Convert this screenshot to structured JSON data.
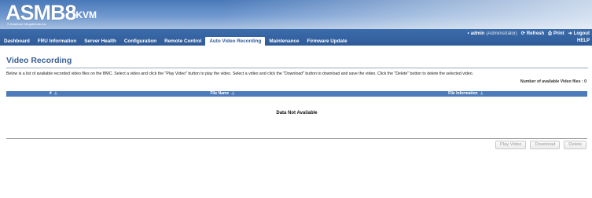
{
  "branding": {
    "logo_main": "ASMB8",
    "logo_sub": "iKVM",
    "logo_tag": "© American Megatrends Inc."
  },
  "utility": {
    "user": "admin",
    "role": "(Administrator)",
    "refresh": "Refresh",
    "print": "Print",
    "logout": "Logout",
    "help": "HELP"
  },
  "nav": {
    "items": [
      {
        "label": "Dashboard"
      },
      {
        "label": "FRU Information"
      },
      {
        "label": "Server Health"
      },
      {
        "label": "Configuration"
      },
      {
        "label": "Remote Control"
      },
      {
        "label": "Auto Video Recording"
      },
      {
        "label": "Maintenance"
      },
      {
        "label": "Firmware Update"
      }
    ],
    "active_index": 5
  },
  "page": {
    "title": "Video Recording",
    "description": "Below is a list of available recorded video files on the BMC. Select a video and click the \"Play Video\" button to play the video. Select a video and click the \"Download\" button to download and save the video. Click the \"Delete\" button to delete the selected video.",
    "count_label": "Number of available Video files : 0"
  },
  "table": {
    "columns": [
      {
        "label": "#"
      },
      {
        "label": "File Name"
      },
      {
        "label": "File Information"
      }
    ],
    "empty_text": "Data Not Available"
  },
  "actions": {
    "play": "Play Video",
    "download": "Download",
    "delete": "Delete"
  },
  "colors": {
    "header_blue": "#4a79b9",
    "nav_blue": "#2f5b98",
    "title_blue": "#3a5f94",
    "table_header": "#4d7bb9"
  },
  "icons": {
    "refresh": "refresh-icon",
    "print": "print-icon",
    "logout": "logout-icon",
    "sort": "sort-icon"
  }
}
